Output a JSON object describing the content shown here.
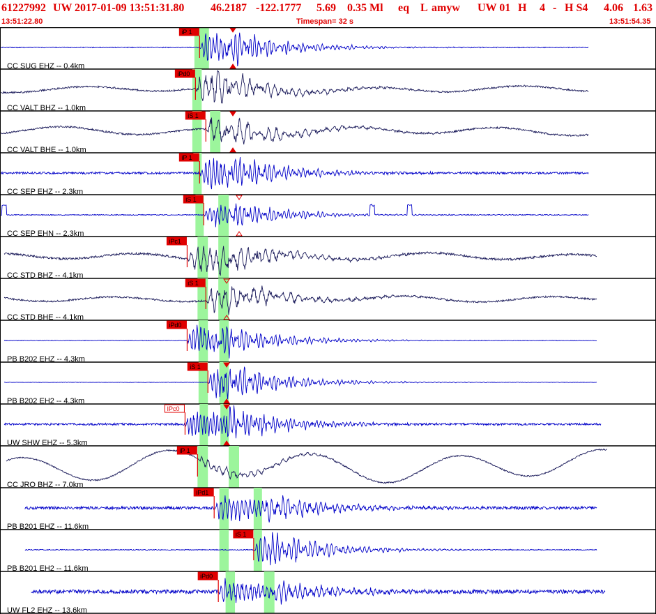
{
  "header": {
    "evid": "61227992",
    "network": "UW",
    "origin_time": "2017-01-09 13:51:31.80",
    "lat": "46.2187",
    "lon": "-122.1777",
    "depth": "5.69",
    "magnitude": "0.35 Ml",
    "etype": "eq",
    "gtype": "L",
    "author": "amyw",
    "src": "UW 01",
    "flag": "H",
    "count": "4",
    "dash": "-",
    "quality": "H S4",
    "rms": "4.06",
    "gap": "1.63"
  },
  "subheader": {
    "start_time": "13:51:22.80",
    "timespan": "Timespan=  32 s",
    "end_time": "13:51:54.35"
  },
  "colors": {
    "header_red": "#e00000",
    "trace_blue": "#0000c8",
    "trace_navy": "#1a1a5a",
    "pick_red": "#e00000",
    "pick_window_green": "#9cf59c",
    "panel_border": "#000000"
  },
  "traces": [
    {
      "label": "CC SUG EHZ -- 0.4km",
      "color": "trace_blue",
      "pick": "iP 1",
      "pick_style": "filled",
      "pick_t": 9.6,
      "s_t": 10.9,
      "tri_t": 11.2,
      "tri_type": "up-down",
      "amp": 0.38,
      "noise": 0.02,
      "period": 0.18,
      "green": [
        9.35,
        10.05
      ],
      "long": 0,
      "start": 0.05,
      "end": 28.3
    },
    {
      "label": "CC VALT BHZ -- 1.0km",
      "color": "trace_navy",
      "pick": "iPd0",
      "pick_style": "filled",
      "pick_t": 9.4,
      "s_t": 10.2,
      "tri_t": 11.2,
      "tri_type": "none",
      "amp": 0.35,
      "noise": 0.04,
      "period": 0.3,
      "green": [
        9.25,
        9.7
      ],
      "long": 0.06,
      "start": 0.05,
      "end": 28.3
    },
    {
      "label": "CC VALT BHE -- 1.0km",
      "color": "trace_navy",
      "pick": "iS 1",
      "pick_style": "filled",
      "pick_t": 9.9,
      "s_t": 10.7,
      "tri_t": 11.2,
      "tri_type": "down-up",
      "amp": 0.3,
      "noise": 0.04,
      "period": 0.35,
      "green": [
        9.25,
        9.7,
        10.1,
        10.6
      ],
      "long": 0.08,
      "start": 0.05,
      "end": 28.3
    },
    {
      "label": "CC SEP EHZ -- 2.3km",
      "color": "trace_blue",
      "pick": "iP 1",
      "pick_style": "filled",
      "pick_t": 9.6,
      "s_t": 10.9,
      "tri_t": 10.9,
      "tri_type": "none",
      "amp": 0.38,
      "noise": 0.05,
      "period": 0.18,
      "green": [
        9.3,
        9.7
      ],
      "long": 0,
      "start": 0.05,
      "end": 28.3
    },
    {
      "label": "CC SEP EHN -- 2.3km",
      "color": "trace_blue",
      "pick": "iS 1",
      "pick_style": "filled",
      "pick_t": 9.8,
      "s_t": 10.9,
      "tri_t": 11.5,
      "tri_type": "open",
      "amp": 0.28,
      "noise": 0.02,
      "period": 0.18,
      "green": [
        9.4,
        9.8,
        10.5,
        11.0
      ],
      "long": 0,
      "start": 0.05,
      "end": 28.3,
      "spikes": [
        0.2,
        17.9,
        19.7
      ]
    },
    {
      "label": "CC STD BHZ -- 4.1km",
      "color": "trace_navy",
      "pick": "iPc1",
      "pick_style": "filled",
      "pick_t": 9.0,
      "s_t": 10.5,
      "tri_t": 10.5,
      "tri_type": "none",
      "amp": 0.35,
      "noise": 0.05,
      "period": 0.3,
      "green": [
        9.5,
        10.0,
        10.5,
        11.0
      ],
      "long": 0.07,
      "start": 0.2,
      "end": 28.7
    },
    {
      "label": "CC STD BHE -- 4.1km",
      "color": "trace_navy",
      "pick": "iS 1",
      "pick_style": "filled",
      "pick_t": 9.9,
      "s_t": 10.9,
      "tri_t": 10.9,
      "tri_type": "open-down",
      "amp": 0.3,
      "noise": 0.04,
      "period": 0.35,
      "green": [
        9.5,
        10.0,
        10.5,
        11.0
      ],
      "long": 0.06,
      "start": 0.2,
      "end": 28.7
    },
    {
      "label": "PB B202 EHZ -- 4.3km",
      "color": "trace_blue",
      "pick": "iPd0",
      "pick_style": "filled",
      "pick_t": 9.0,
      "s_t": 10.5,
      "tri_t": 10.5,
      "tri_type": "none",
      "amp": 0.35,
      "noise": 0.015,
      "period": 0.18,
      "green": [
        9.55,
        10.0,
        10.55,
        11.0
      ],
      "long": 0,
      "start": 0.2,
      "end": 28.7
    },
    {
      "label": "PB B202 EH2 -- 4.3km",
      "color": "trace_blue",
      "pick": "iS 1",
      "pick_style": "filled",
      "pick_t": 10.0,
      "s_t": 10.9,
      "tri_t": 10.9,
      "tri_type": "down",
      "amp": 0.35,
      "noise": 0.01,
      "period": 0.18,
      "green": [
        9.55,
        10.0,
        10.55,
        11.0
      ],
      "long": 0,
      "start": 0.2,
      "end": 28.7
    },
    {
      "label": "UW SHW EHZ -- 5.3km",
      "color": "trace_blue",
      "pick": "IPc0",
      "pick_style": "open",
      "pick_t": 8.9,
      "s_t": 10.9,
      "tri_t": 10.9,
      "tri_type": "down",
      "amp": 0.4,
      "noise": 0.05,
      "period": 0.16,
      "green": [
        9.6,
        10.0,
        10.6,
        11.0
      ],
      "long": 0,
      "start": 0.2,
      "end": 28.9
    },
    {
      "label": "CC JRO BHZ -- 7.0km",
      "color": "trace_navy",
      "pick": "iP 1",
      "pick_style": "filled",
      "pick_t": 9.5,
      "s_t": 10.2,
      "tri_t": 10.2,
      "tri_type": "none",
      "amp": 0.12,
      "noise": 0.03,
      "period": 0.3,
      "green": [
        9.5,
        10.0,
        11.0,
        11.5
      ],
      "long": 0.3,
      "start": 0.3,
      "end": 29.2
    },
    {
      "label": "PB B201 EHZ -- 11.6km",
      "color": "trace_blue",
      "pick": "iPd1",
      "pick_style": "filled",
      "pick_t": 10.3,
      "s_t": 12.9,
      "tri_t": 12.9,
      "tri_type": "none",
      "amp": 0.35,
      "noise": 0.07,
      "period": 0.2,
      "green": [
        10.55,
        11.0,
        12.2,
        12.6
      ],
      "long": 0,
      "start": 1.2,
      "end": 28.7
    },
    {
      "label": "PB B201 EH2 -- 11.6km",
      "color": "trace_blue",
      "pick": "iS 1",
      "pick_style": "filled",
      "pick_t": 12.2,
      "s_t": 12.9,
      "tri_t": 12.9,
      "tri_type": "none",
      "amp": 0.33,
      "noise": 0.02,
      "period": 0.2,
      "green": [
        10.55,
        11.0,
        12.2,
        12.6
      ],
      "long": 0,
      "start": 1.2,
      "end": 28.7
    },
    {
      "label": "UW FL2 EHZ -- 13.6km",
      "color": "trace_blue",
      "pick": "iPd0",
      "pick_style": "filled",
      "pick_t": 10.5,
      "s_t": 13.2,
      "tri_t": 13.2,
      "tri_type": "none",
      "amp": 0.3,
      "noise": 0.09,
      "period": 0.2,
      "green": [
        10.85,
        11.3,
        12.7,
        13.2
      ],
      "long": 0,
      "start": 1.5,
      "end": 29.1
    }
  ]
}
